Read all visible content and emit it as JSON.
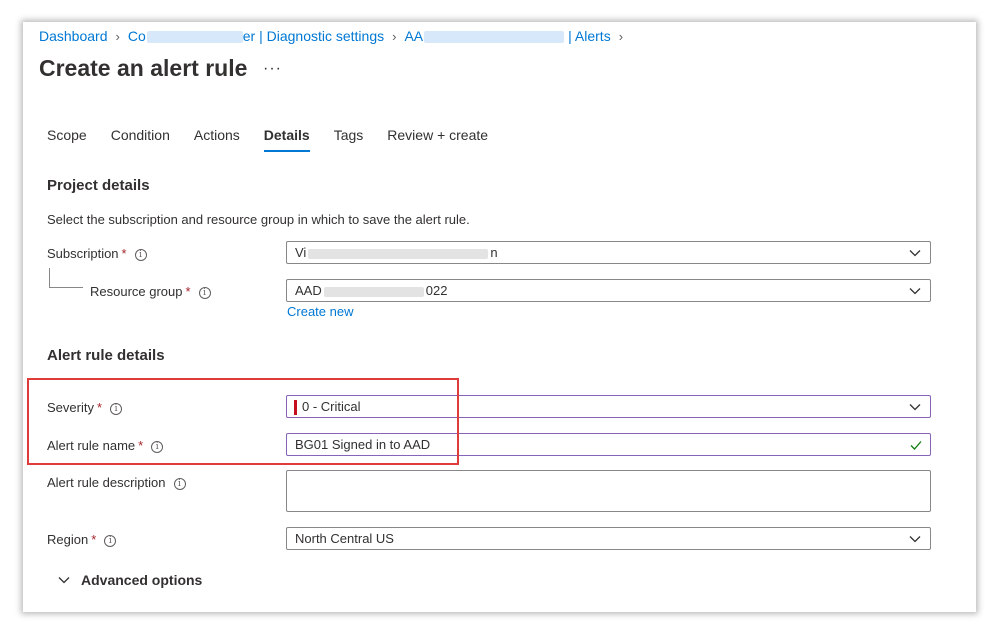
{
  "breadcrumb": {
    "items": [
      "Dashboard",
      "Co",
      "er | Diagnostic settings",
      "AA",
      "| Alerts"
    ]
  },
  "page": {
    "title": "Create an alert rule",
    "more": "···"
  },
  "tabs": [
    "Scope",
    "Condition",
    "Actions",
    "Details",
    "Tags",
    "Review + create"
  ],
  "active_tab": "Details",
  "project": {
    "heading": "Project details",
    "description": "Select the subscription and resource group in which to save the alert rule.",
    "subscription_label": "Subscription",
    "subscription_value_start": "Vi",
    "subscription_value_end": "n",
    "resource_group_label": "Resource group",
    "resource_group_value_start": "AAD",
    "resource_group_value_end": "022",
    "create_new": "Create new"
  },
  "alert": {
    "heading": "Alert rule details",
    "severity_label": "Severity",
    "severity_value": "0 - Critical",
    "name_label": "Alert rule name",
    "name_value": "BG01 Signed in to AAD",
    "description_label": "Alert rule description",
    "description_value": "",
    "region_label": "Region",
    "region_value": "North Central US",
    "advanced_options": "Advanced options"
  },
  "required_marker": "*",
  "info_glyph": "i",
  "colors": {
    "accent": "#0078d4",
    "highlight_border": "#8764b8",
    "required": "#a4262c",
    "annotation_box": "#e03b3b",
    "severity_critical": "#c50f1f",
    "check": "#107c10"
  }
}
